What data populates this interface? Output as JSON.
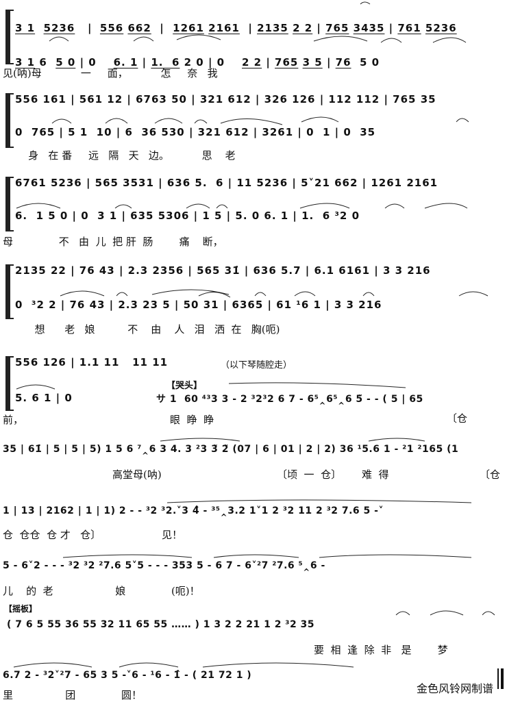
{
  "score": {
    "systems": [
      {
        "upper": "3 1̇  5236 | 556 662 | 1261 2161 | 2135 22 | 765 3435 | 761̇ 5236",
        "lower": "3 1 6 50 | 0  6. 1 | 1.  6 ³2 0 | 0  ³2 2 | 765 3 5 | 76  5 0",
        "lyrics": "见(呐)母            一     面，          怎     奈   我"
      },
      {
        "upper": "556 161 | 561 12 | 6763 50 | 321 612 | 326 126 | 112 112 | 765 35",
        "lower": "0  765 | 5 1  10 | 6  36 530 | 321 612 | 3261 | 0  1 | 0  35",
        "lyrics": "    身   在 番     远   隔   天   边。          思    老"
      },
      {
        "upper": "6761 5236 | 565 3531 | 636 5.  6 | 11 5236 | 5˅21 662 | 1261 2161",
        "lower": "6.  1 5 0 | 0  3 1 | 635 5306 | 1 5 | 5. 0 6. 1 | 1.  6 ³2 0",
        "lyrics": "母              不   由  儿  把 肝  肠        痛    断，"
      },
      {
        "upper": "2135 22 | 76 43 | 2.3 2356 | 565 31̇ | 636 5.7 | 6.1 6161 | 3 3 216",
        "lower": "0  ³2 2 | 76 43 | 2.3 23 5 | 50 31 | 6365 | 61 ¹6 1 | 3 3 216",
        "lyrics": "      想      老   娘          不    由    人   泪   洒  在   胸(呃)"
      },
      {
        "upper": "556 126 | 1.1 11   11 11",
        "upper_note": "（以下琴随腔走）",
        "lower": "5. 6 1 | 0",
        "section_label": "【哭头】",
        "free_meter": "サ 1  60 ⁴³3 3 - 2 ³2³2 6 7 - 6⁵‸6⁵‸6 5̃ - - ( 5 | 65",
        "lyrics_left": "前，",
        "lyrics_right": "眼  睁  睁",
        "percussion_right": "〔仓"
      },
      {
        "notes": "35 | 61̇ | 5 | 5 | 5) 1 5 6 ⁷‸6 3 4. 3 ²3 3̃ 2̃ (07 | 6 | 01 | 2 | 2) 36 ¹5.6 1 - ²1 ²165 (1",
        "lyrics": "高堂母(呐)",
        "percussion": "〔顷  一  仓〕",
        "lyrics2": "难  得",
        "percussion_end": "〔仓"
      },
      {
        "notes": "1 | 13 | 2162 | 1 | 1) 2 - - ³2 ³2.˅3 4̂ - ³⁵‸3.2 1˅1 2 ³2 11 2 ³2 7.6 5 -˅",
        "percussion": "仓  仓仓  仓 才   仓〕",
        "lyrics": "见！"
      },
      {
        "notes": "5 - 6˅2 - - - ³2 ³2 ²7.6 5˅5 - - - 353 5 - 6 7 - 6˅²7 ²7.6 ⁵‸6 -",
        "lyrics": "儿    的  老                   娘              (呃)！"
      },
      {
        "section_label": "【摇板】",
        "notes": "( 7 6 5 55 36 55 32 11 65 55 …… ) 1 3 2 2 21 1 2 ³2 35",
        "lyrics": "要  相  逢  除  非   是        梦"
      },
      {
        "notes": "6.7 2 - ³2˅²7 - 65 3 5 -˅6 - ¹6 - 1̂ - ( 21 72 1 )",
        "lyrics": "里                团              圆！"
      }
    ],
    "credit": "金色风铃网制谱"
  }
}
